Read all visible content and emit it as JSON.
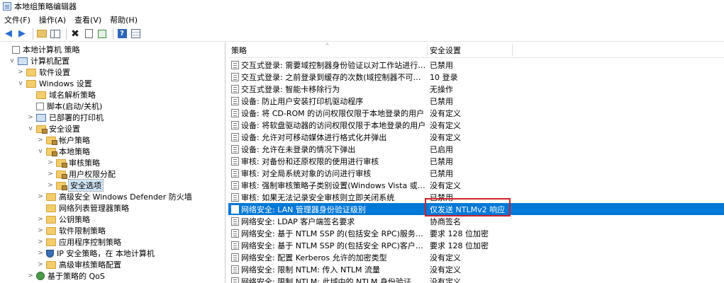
{
  "window": {
    "title": "本地组策略编辑器"
  },
  "menubar": [
    {
      "label": "文件(F)"
    },
    {
      "label": "操作(A)"
    },
    {
      "label": "查看(V)"
    },
    {
      "label": "帮助(H)"
    }
  ],
  "toolbar": {
    "icons": [
      "back-arrow-icon",
      "forward-arrow-icon",
      "up-folder-icon",
      "show-tree-icon",
      "delete-icon",
      "properties-icon",
      "export-list-icon",
      "help-icon",
      "view-icon"
    ]
  },
  "tree": [
    {
      "label": "本地计算机 策略",
      "level": 0,
      "expander": "",
      "icon": "policy-doc-icon"
    },
    {
      "label": "计算机配置",
      "level": 1,
      "expander": "v",
      "icon": "computer-icon"
    },
    {
      "label": "软件设置",
      "level": 2,
      "expander": ">",
      "icon": "folder-icon"
    },
    {
      "label": "Windows 设置",
      "level": 2,
      "expander": "v",
      "icon": "folder-icon"
    },
    {
      "label": "域名解析策略",
      "level": 3,
      "expander": "",
      "icon": "folder-icon"
    },
    {
      "label": "脚本(启动/关机)",
      "level": 3,
      "expander": "",
      "icon": "script-doc-icon"
    },
    {
      "label": "已部署的打印机",
      "level": 3,
      "expander": ">",
      "icon": "printer-icon"
    },
    {
      "label": "安全设置",
      "level": 3,
      "expander": "v",
      "icon": "lock-folder-icon"
    },
    {
      "label": "帐户策略",
      "level": 4,
      "expander": ">",
      "icon": "lock-folder-icon"
    },
    {
      "label": "本地策略",
      "level": 4,
      "expander": "v",
      "icon": "lock-folder-icon"
    },
    {
      "label": "审核策略",
      "level": 5,
      "expander": ">",
      "icon": "lock-folder-icon"
    },
    {
      "label": "用户权限分配",
      "level": 5,
      "expander": ">",
      "icon": "lock-folder-icon"
    },
    {
      "label": "安全选项",
      "level": 5,
      "expander": ">",
      "icon": "lock-folder-icon",
      "selected": true
    },
    {
      "label": "高级安全 Windows Defender 防火墙",
      "level": 4,
      "expander": ">",
      "icon": "folder-icon"
    },
    {
      "label": "网络列表管理器策略",
      "level": 4,
      "expander": "",
      "icon": "folder-icon"
    },
    {
      "label": "公钥策略",
      "level": 4,
      "expander": ">",
      "icon": "folder-icon"
    },
    {
      "label": "软件限制策略",
      "level": 4,
      "expander": ">",
      "icon": "folder-icon"
    },
    {
      "label": "应用程序控制策略",
      "level": 4,
      "expander": ">",
      "icon": "folder-icon"
    },
    {
      "label": "IP 安全策略，在 本地计算机",
      "level": 4,
      "expander": ">",
      "icon": "shield-icon"
    },
    {
      "label": "高级审核策略配置",
      "level": 4,
      "expander": ">",
      "icon": "folder-icon"
    },
    {
      "label": "基于策略的 QoS",
      "level": 3,
      "expander": ">",
      "icon": "qos-icon"
    }
  ],
  "list": {
    "columns": {
      "policy": "策略",
      "setting": "安全设置"
    },
    "rows": [
      {
        "policy": "交互式登录: 需要域控制器身份验证以对工作站进行解锁",
        "setting": "已禁用"
      },
      {
        "policy": "交互式登录: 之前登录到缓存的次数(域控制器不可用时)",
        "setting": "10 登录"
      },
      {
        "policy": "交互式登录: 智能卡移除行为",
        "setting": "无操作"
      },
      {
        "policy": "设备: 防止用户安装打印机驱动程序",
        "setting": "已禁用"
      },
      {
        "policy": "设备: 将 CD-ROM 的访问权限仅限于本地登录的用户",
        "setting": "没有定义"
      },
      {
        "policy": "设备: 将软盘驱动器的访问权限仅限于本地登录的用户",
        "setting": "没有定义"
      },
      {
        "policy": "设备: 允许对可移动媒体进行格式化并弹出",
        "setting": "没有定义"
      },
      {
        "policy": "设备: 允许在未登录的情况下弹出",
        "setting": "已启用"
      },
      {
        "policy": "审核: 对备份和还原权限的使用进行审核",
        "setting": "已禁用"
      },
      {
        "policy": "审核: 对全局系统对象的访问进行审核",
        "setting": "已禁用"
      },
      {
        "policy": "审核: 强制审核策略子类别设置(Windows Vista 或更高版本...",
        "setting": "没有定义"
      },
      {
        "policy": "审核: 如果无法记录安全审核则立即关闭系统",
        "setting": "已禁用"
      },
      {
        "policy": "网络安全: LAN 管理器身份验证级别",
        "setting": "仅发送 NTLMv2 响应",
        "selected": true
      },
      {
        "policy": "网络安全: LDAP 客户端签名要求",
        "setting": "协商签名"
      },
      {
        "policy": "网络安全: 基于 NTLM SSP 的(包括安全 RPC)服务器的最小...",
        "setting": "要求 128 位加密"
      },
      {
        "policy": "网络安全: 基于 NTLM SSP 的(包括安全 RPC)客户端的最小...",
        "setting": "要求 128 位加密"
      },
      {
        "policy": "网络安全: 配置 Kerberos 允许的加密类型",
        "setting": "没有定义"
      },
      {
        "policy": "网络安全: 限制 NTLM: 传入 NTLM 流量",
        "setting": "没有定义"
      },
      {
        "policy": "网络安全: 限制 NTLM: 此域中的 NTLM 身份验证",
        "setting": "没有定义"
      }
    ]
  },
  "colors": {
    "selection": "#0078d7",
    "highlight_box": "#d0202a",
    "tree_selected": "#d0e4f8"
  }
}
